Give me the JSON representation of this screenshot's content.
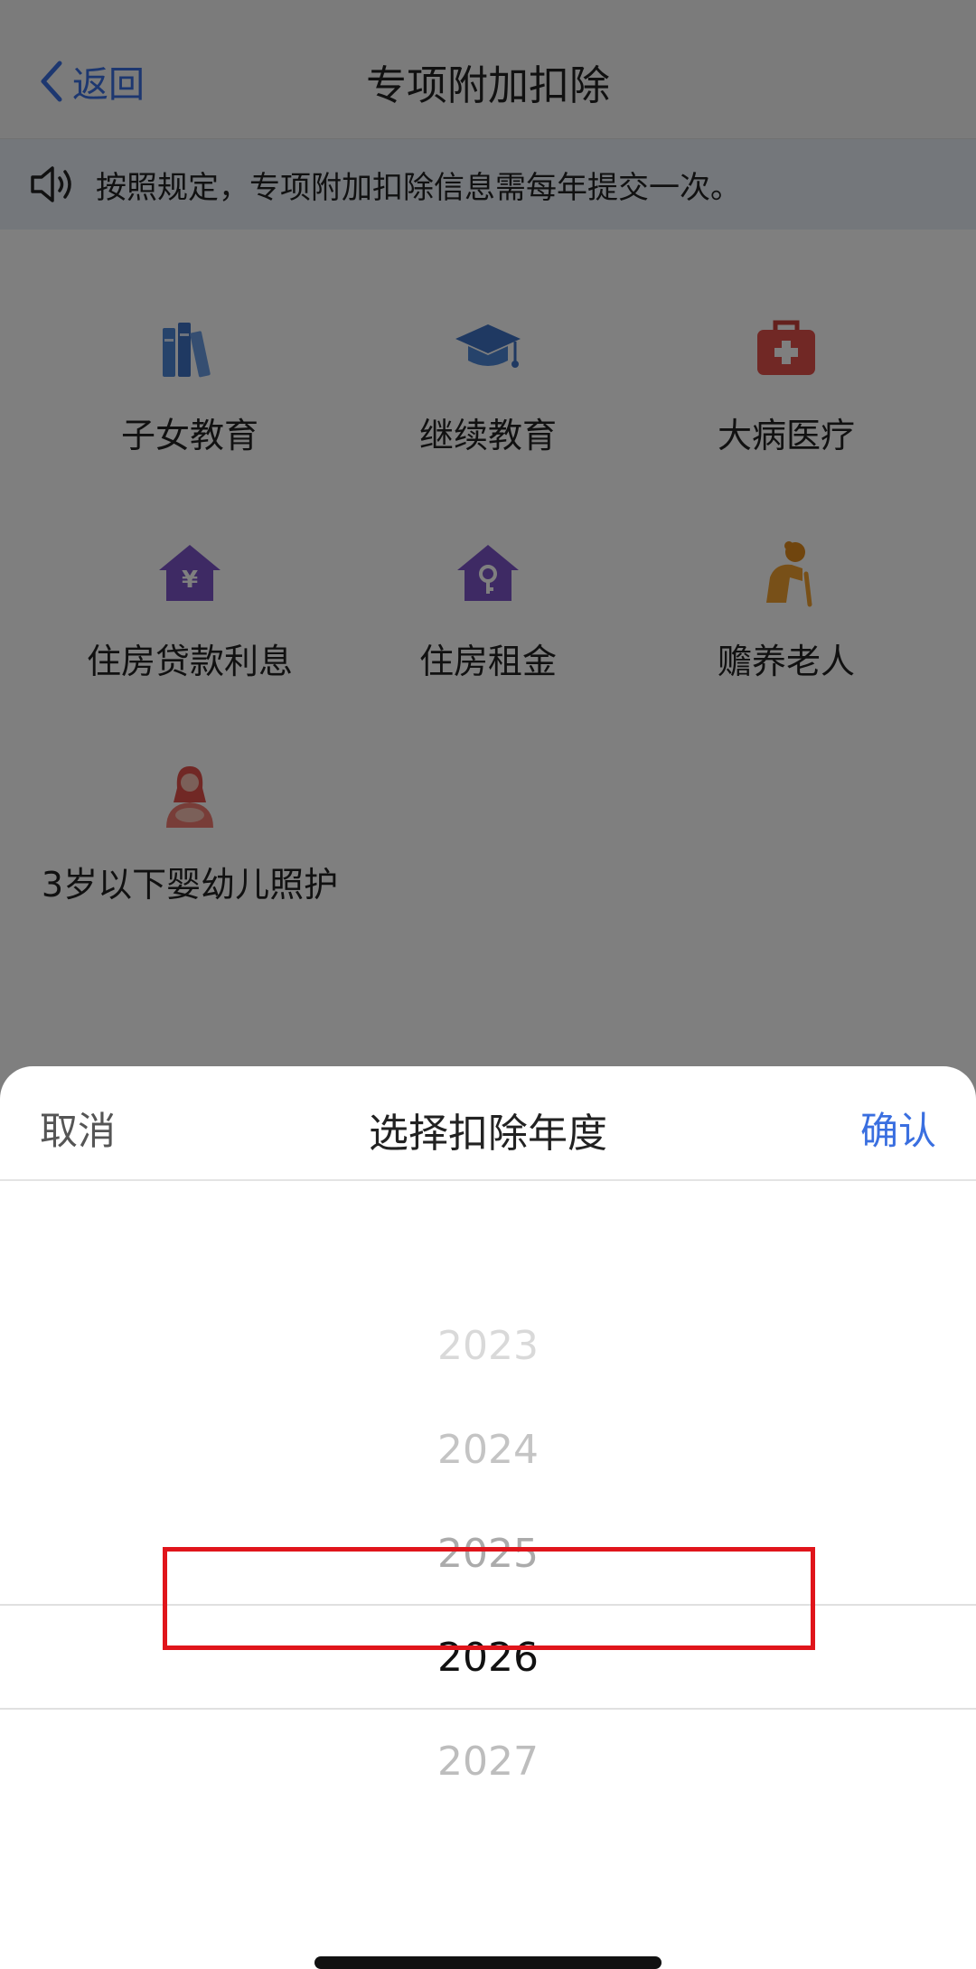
{
  "navbar": {
    "back_label": "返回",
    "title": "专项附加扣除"
  },
  "notice": {
    "text": "按照规定，专项附加扣除信息需每年提交一次。"
  },
  "categories": [
    {
      "label": "子女教育",
      "icon": "books-icon"
    },
    {
      "label": "继续教育",
      "icon": "graduation-cap-icon"
    },
    {
      "label": "大病医疗",
      "icon": "medical-kit-icon"
    },
    {
      "label": "住房贷款利息",
      "icon": "house-yen-icon"
    },
    {
      "label": "住房租金",
      "icon": "house-key-icon"
    },
    {
      "label": "赡养老人",
      "icon": "elderly-person-icon"
    },
    {
      "label": "3岁以下婴幼儿照护",
      "icon": "mother-baby-icon"
    }
  ],
  "sheet": {
    "cancel_label": "取消",
    "title": "选择扣除年度",
    "confirm_label": "确认",
    "years": [
      "2023",
      "2024",
      "2025",
      "2026",
      "2027"
    ],
    "selected_year": "2026"
  },
  "colors": {
    "accent": "#3a6fe0",
    "highlight_border": "#e0151b",
    "icon_blue": "#4d86d6",
    "icon_red": "#e2514a",
    "icon_purple": "#7c55c9",
    "icon_orange": "#f0a130",
    "icon_pink": "#f07a70"
  }
}
